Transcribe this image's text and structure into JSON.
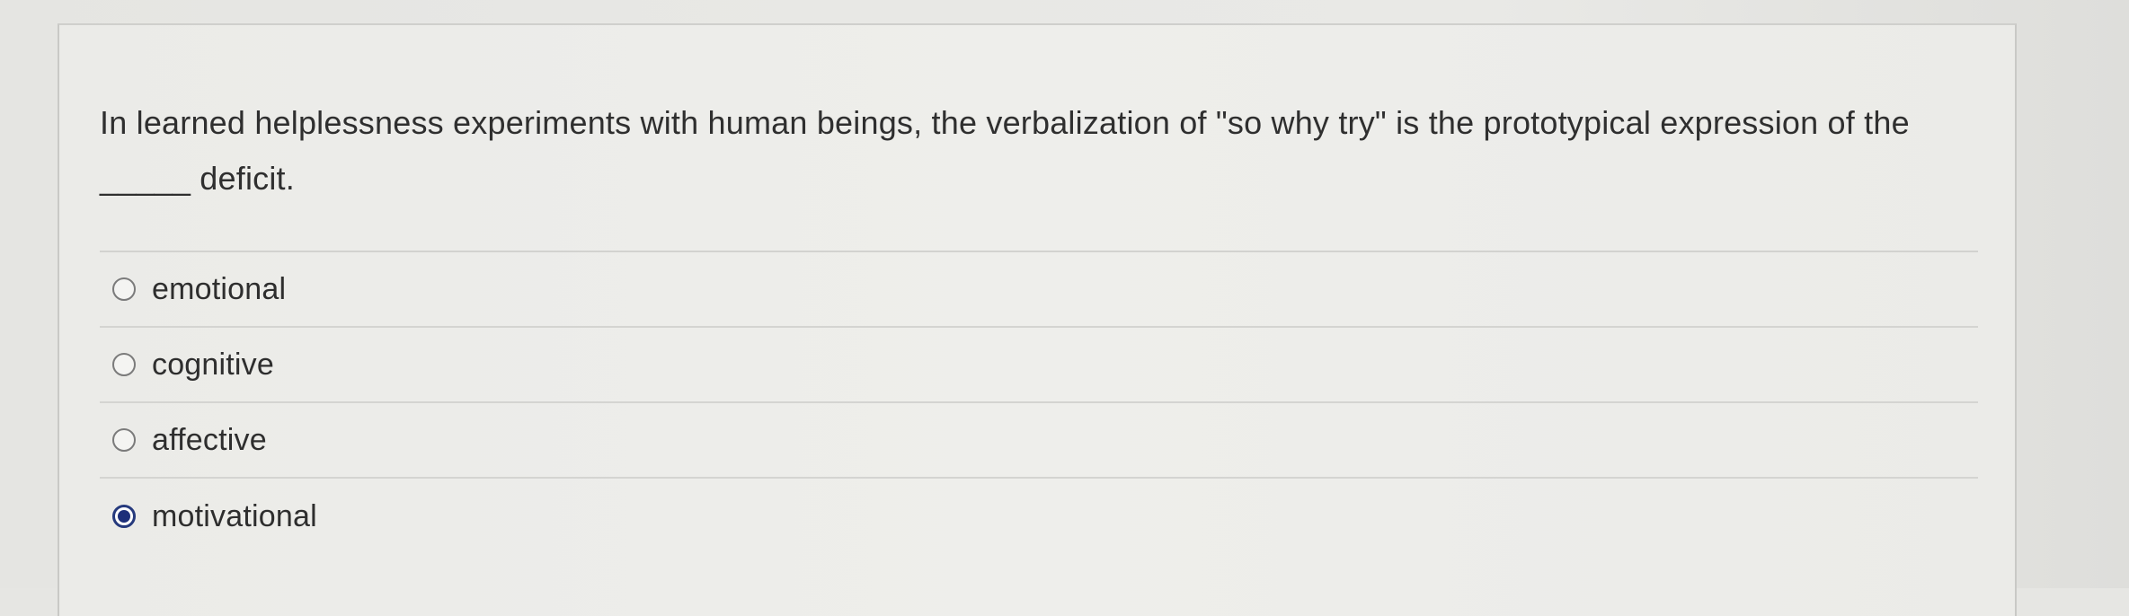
{
  "question": {
    "text": "In learned helplessness experiments with human beings, the verbalization of \"so why try\" is the prototypical expression of the _____ deficit."
  },
  "choices": [
    {
      "label": "emotional",
      "selected": false
    },
    {
      "label": "cognitive",
      "selected": false
    },
    {
      "label": "affective",
      "selected": false
    },
    {
      "label": "motivational",
      "selected": true
    }
  ],
  "colors": {
    "selected_radio": "#1d2f79",
    "background": "#e6e6e3",
    "text": "#2f2f2f"
  },
  "icons": {
    "radio_unselected": "radio-empty-icon",
    "radio_selected": "radio-filled-icon"
  }
}
